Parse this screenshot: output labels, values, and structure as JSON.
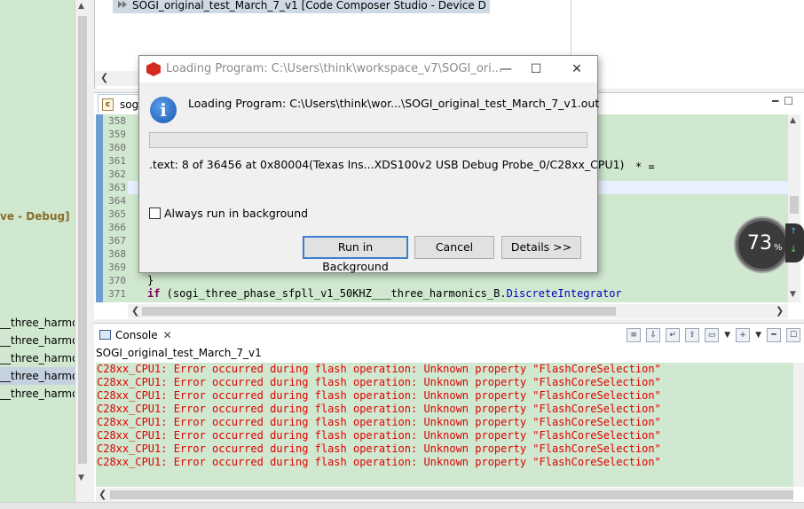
{
  "debug_view": {
    "row_text": "SOGI_original_test_March_7_v1 [Code Composer Studio - Device D"
  },
  "left_panel": {
    "debug_label": "ve - Debug]",
    "items": [
      "__three_harmo",
      "__three_harmo",
      "__three_harmo",
      "__three_harmo",
      "__three_harmo"
    ]
  },
  "editor": {
    "tab_label": "sogi",
    "line_numbers": [
      "358",
      "359",
      "360",
      "361",
      "362",
      "363",
      "364",
      "365",
      "366",
      "367",
      "368",
      "369",
      "370",
      "371"
    ],
    "partial_code_tail": "* =",
    "code_line_370": "}",
    "code_line_371_kw": "if",
    "code_line_371_text": " (sogi_three_phase_sfpll_v1_50KHZ___three_harmonics_B.",
    "code_line_371_field": "DiscreteIntegrator"
  },
  "console": {
    "tab_label": "Console",
    "close_glyph": "✕",
    "title": "SOGI_original_test_March_7_v1",
    "error_lines": [
      "C28xx_CPU1: Error occurred during flash operation: Unknown property \"FlashCoreSelection\"",
      "C28xx_CPU1: Error occurred during flash operation: Unknown property \"FlashCoreSelection\"",
      "C28xx_CPU1: Error occurred during flash operation: Unknown property \"FlashCoreSelection\"",
      "C28xx_CPU1: Error occurred during flash operation: Unknown property \"FlashCoreSelection\"",
      "C28xx_CPU1: Error occurred during flash operation: Unknown property \"FlashCoreSelection\"",
      "C28xx_CPU1: Error occurred during flash operation: Unknown property \"FlashCoreSelection\"",
      "C28xx_CPU1: Error occurred during flash operation: Unknown property \"FlashCoreSelection\"",
      "C28xx_CPU1: Error occurred during flash operation: Unknown property \"FlashCoreSelection\""
    ],
    "error_color": "#e00000"
  },
  "gauge": {
    "value": "73",
    "unit": "%"
  },
  "dialog": {
    "title": "Loading Program: C:\\Users\\think\\workspace_v7\\SOGI_ori...",
    "message": "Loading Program: C:\\Users\\think\\wor...\\SOGI_original_test_March_7_v1.out",
    "progress_fraction": 0.0,
    "detail": ".text: 8 of 36456 at 0x80004(Texas Ins...XDS100v2 USB Debug Probe_0/C28xx_CPU1)",
    "always_run_label": "Always run in background",
    "always_run_checked": false,
    "buttons": {
      "run_in_background": "Run in Background",
      "cancel": "Cancel",
      "details": "Details >>"
    },
    "window_buttons": {
      "minimize": "—",
      "maximize": "☐",
      "close": "✕"
    }
  },
  "icons": {
    "app": "ccs-cube-icon",
    "info": "info-icon",
    "console": "console-monitor-icon",
    "source_file": "c-file-icon"
  },
  "colors": {
    "editor_background": "#cfe8cf",
    "keyword": "#7f0055",
    "field": "#0000c0",
    "default_button_border": "#3c7fd0",
    "app_icon": "#d42a1e"
  }
}
